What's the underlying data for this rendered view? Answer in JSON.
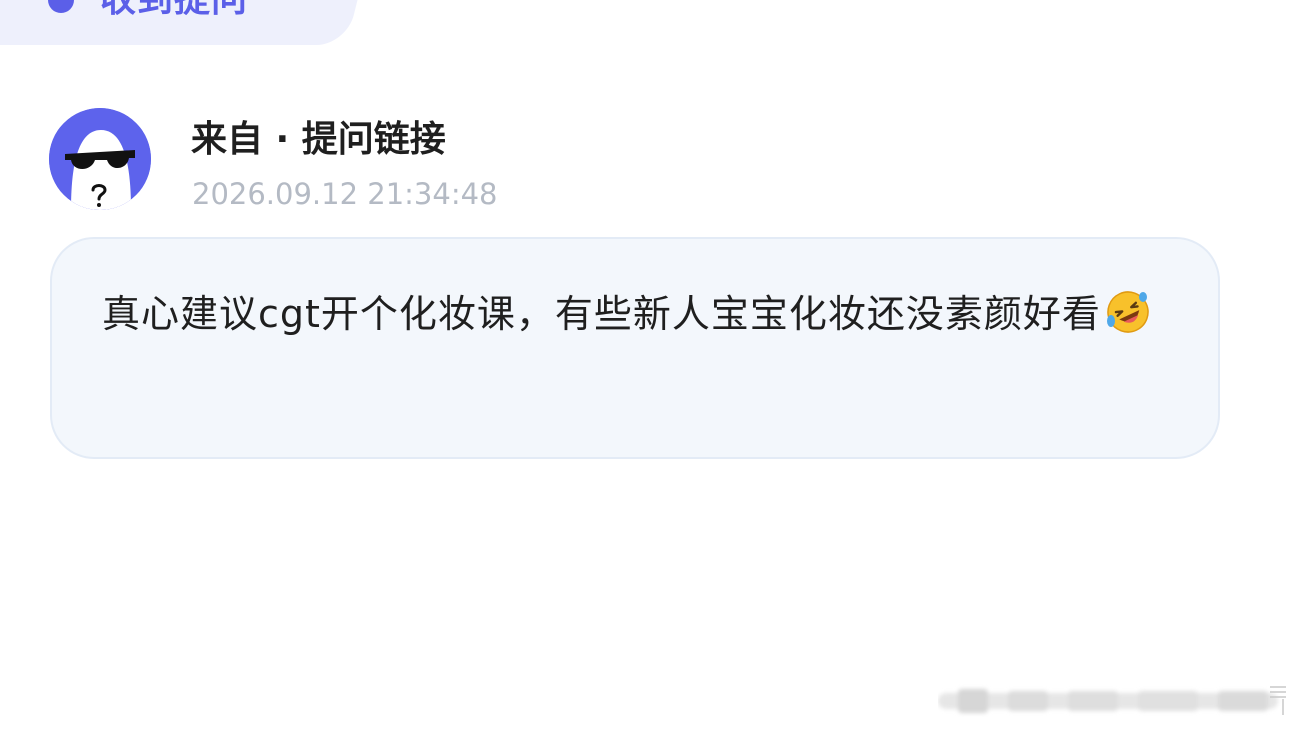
{
  "header": {
    "title": "收到提问"
  },
  "author": {
    "name": "来自 · 提问链接",
    "timestamp": "2026.09.12 21:34:48"
  },
  "message": {
    "text": "真心建议cgt开个化妆课，有些新人宝宝化妆还没素颜好看",
    "emoji": "rolling-on-floor-laughing-icon"
  },
  "colors": {
    "accent": "#5b5fe8",
    "bubble_bg": "#f3f7fc",
    "timestamp": "#b4bac4"
  }
}
